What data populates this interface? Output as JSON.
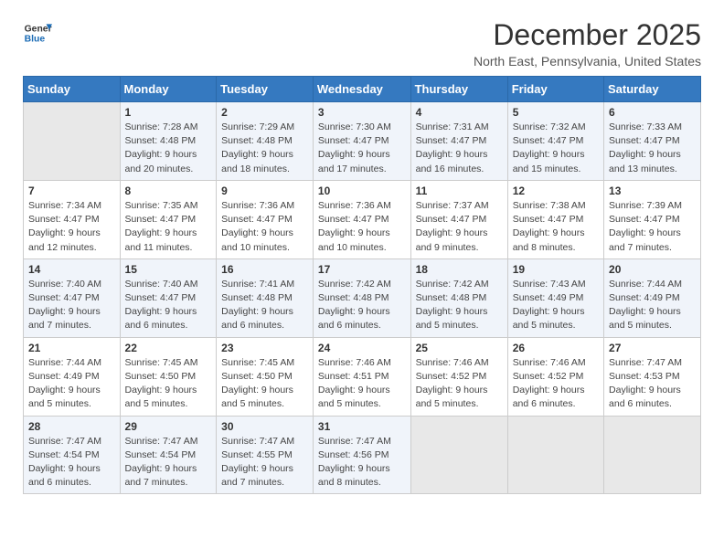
{
  "header": {
    "logo_line1": "General",
    "logo_line2": "Blue",
    "month_title": "December 2025",
    "location": "North East, Pennsylvania, United States"
  },
  "days_of_week": [
    "Sunday",
    "Monday",
    "Tuesday",
    "Wednesday",
    "Thursday",
    "Friday",
    "Saturday"
  ],
  "weeks": [
    [
      {
        "day": "",
        "sunrise": "",
        "sunset": "",
        "daylight": ""
      },
      {
        "day": "1",
        "sunrise": "Sunrise: 7:28 AM",
        "sunset": "Sunset: 4:48 PM",
        "daylight": "Daylight: 9 hours and 20 minutes."
      },
      {
        "day": "2",
        "sunrise": "Sunrise: 7:29 AM",
        "sunset": "Sunset: 4:48 PM",
        "daylight": "Daylight: 9 hours and 18 minutes."
      },
      {
        "day": "3",
        "sunrise": "Sunrise: 7:30 AM",
        "sunset": "Sunset: 4:47 PM",
        "daylight": "Daylight: 9 hours and 17 minutes."
      },
      {
        "day": "4",
        "sunrise": "Sunrise: 7:31 AM",
        "sunset": "Sunset: 4:47 PM",
        "daylight": "Daylight: 9 hours and 16 minutes."
      },
      {
        "day": "5",
        "sunrise": "Sunrise: 7:32 AM",
        "sunset": "Sunset: 4:47 PM",
        "daylight": "Daylight: 9 hours and 15 minutes."
      },
      {
        "day": "6",
        "sunrise": "Sunrise: 7:33 AM",
        "sunset": "Sunset: 4:47 PM",
        "daylight": "Daylight: 9 hours and 13 minutes."
      }
    ],
    [
      {
        "day": "7",
        "sunrise": "Sunrise: 7:34 AM",
        "sunset": "Sunset: 4:47 PM",
        "daylight": "Daylight: 9 hours and 12 minutes."
      },
      {
        "day": "8",
        "sunrise": "Sunrise: 7:35 AM",
        "sunset": "Sunset: 4:47 PM",
        "daylight": "Daylight: 9 hours and 11 minutes."
      },
      {
        "day": "9",
        "sunrise": "Sunrise: 7:36 AM",
        "sunset": "Sunset: 4:47 PM",
        "daylight": "Daylight: 9 hours and 10 minutes."
      },
      {
        "day": "10",
        "sunrise": "Sunrise: 7:36 AM",
        "sunset": "Sunset: 4:47 PM",
        "daylight": "Daylight: 9 hours and 10 minutes."
      },
      {
        "day": "11",
        "sunrise": "Sunrise: 7:37 AM",
        "sunset": "Sunset: 4:47 PM",
        "daylight": "Daylight: 9 hours and 9 minutes."
      },
      {
        "day": "12",
        "sunrise": "Sunrise: 7:38 AM",
        "sunset": "Sunset: 4:47 PM",
        "daylight": "Daylight: 9 hours and 8 minutes."
      },
      {
        "day": "13",
        "sunrise": "Sunrise: 7:39 AM",
        "sunset": "Sunset: 4:47 PM",
        "daylight": "Daylight: 9 hours and 7 minutes."
      }
    ],
    [
      {
        "day": "14",
        "sunrise": "Sunrise: 7:40 AM",
        "sunset": "Sunset: 4:47 PM",
        "daylight": "Daylight: 9 hours and 7 minutes."
      },
      {
        "day": "15",
        "sunrise": "Sunrise: 7:40 AM",
        "sunset": "Sunset: 4:47 PM",
        "daylight": "Daylight: 9 hours and 6 minutes."
      },
      {
        "day": "16",
        "sunrise": "Sunrise: 7:41 AM",
        "sunset": "Sunset: 4:48 PM",
        "daylight": "Daylight: 9 hours and 6 minutes."
      },
      {
        "day": "17",
        "sunrise": "Sunrise: 7:42 AM",
        "sunset": "Sunset: 4:48 PM",
        "daylight": "Daylight: 9 hours and 6 minutes."
      },
      {
        "day": "18",
        "sunrise": "Sunrise: 7:42 AM",
        "sunset": "Sunset: 4:48 PM",
        "daylight": "Daylight: 9 hours and 5 minutes."
      },
      {
        "day": "19",
        "sunrise": "Sunrise: 7:43 AM",
        "sunset": "Sunset: 4:49 PM",
        "daylight": "Daylight: 9 hours and 5 minutes."
      },
      {
        "day": "20",
        "sunrise": "Sunrise: 7:44 AM",
        "sunset": "Sunset: 4:49 PM",
        "daylight": "Daylight: 9 hours and 5 minutes."
      }
    ],
    [
      {
        "day": "21",
        "sunrise": "Sunrise: 7:44 AM",
        "sunset": "Sunset: 4:49 PM",
        "daylight": "Daylight: 9 hours and 5 minutes."
      },
      {
        "day": "22",
        "sunrise": "Sunrise: 7:45 AM",
        "sunset": "Sunset: 4:50 PM",
        "daylight": "Daylight: 9 hours and 5 minutes."
      },
      {
        "day": "23",
        "sunrise": "Sunrise: 7:45 AM",
        "sunset": "Sunset: 4:50 PM",
        "daylight": "Daylight: 9 hours and 5 minutes."
      },
      {
        "day": "24",
        "sunrise": "Sunrise: 7:46 AM",
        "sunset": "Sunset: 4:51 PM",
        "daylight": "Daylight: 9 hours and 5 minutes."
      },
      {
        "day": "25",
        "sunrise": "Sunrise: 7:46 AM",
        "sunset": "Sunset: 4:52 PM",
        "daylight": "Daylight: 9 hours and 5 minutes."
      },
      {
        "day": "26",
        "sunrise": "Sunrise: 7:46 AM",
        "sunset": "Sunset: 4:52 PM",
        "daylight": "Daylight: 9 hours and 6 minutes."
      },
      {
        "day": "27",
        "sunrise": "Sunrise: 7:47 AM",
        "sunset": "Sunset: 4:53 PM",
        "daylight": "Daylight: 9 hours and 6 minutes."
      }
    ],
    [
      {
        "day": "28",
        "sunrise": "Sunrise: 7:47 AM",
        "sunset": "Sunset: 4:54 PM",
        "daylight": "Daylight: 9 hours and 6 minutes."
      },
      {
        "day": "29",
        "sunrise": "Sunrise: 7:47 AM",
        "sunset": "Sunset: 4:54 PM",
        "daylight": "Daylight: 9 hours and 7 minutes."
      },
      {
        "day": "30",
        "sunrise": "Sunrise: 7:47 AM",
        "sunset": "Sunset: 4:55 PM",
        "daylight": "Daylight: 9 hours and 7 minutes."
      },
      {
        "day": "31",
        "sunrise": "Sunrise: 7:47 AM",
        "sunset": "Sunset: 4:56 PM",
        "daylight": "Daylight: 9 hours and 8 minutes."
      },
      {
        "day": "",
        "sunrise": "",
        "sunset": "",
        "daylight": ""
      },
      {
        "day": "",
        "sunrise": "",
        "sunset": "",
        "daylight": ""
      },
      {
        "day": "",
        "sunrise": "",
        "sunset": "",
        "daylight": ""
      }
    ]
  ]
}
